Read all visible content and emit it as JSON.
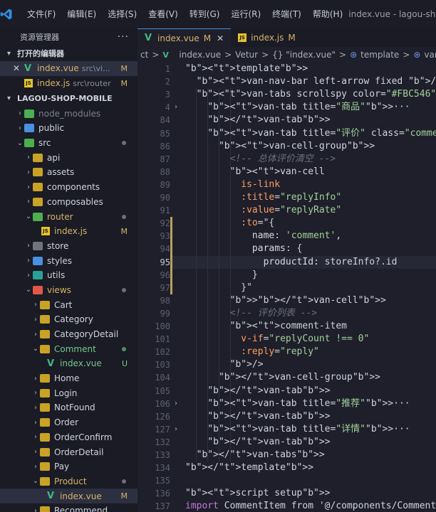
{
  "menubar": {
    "items": [
      "文件(F)",
      "编辑(E)",
      "选择(S)",
      "查看(V)",
      "转到(G)",
      "运行(R)",
      "终端(T)",
      "帮助(H)"
    ],
    "window_title": "index.vue - lagou-sh"
  },
  "explorer": {
    "title": "资源管理器",
    "more": "···",
    "open_editors_label": "打开的编辑器",
    "open_editors": [
      {
        "name": "index.vue",
        "path": "src\\vi...",
        "badge": "M"
      },
      {
        "name": "index.js",
        "path": "src\\router",
        "badge": "M"
      }
    ],
    "project_label": "LAGOU-SHOP-MOBILE",
    "tree": [
      {
        "name": "node_modules"
      },
      {
        "name": "public"
      },
      {
        "name": "src"
      },
      {
        "name": "api"
      },
      {
        "name": "assets"
      },
      {
        "name": "components"
      },
      {
        "name": "composables"
      },
      {
        "name": "router"
      },
      {
        "name": "index.js",
        "badge": "M"
      },
      {
        "name": "store"
      },
      {
        "name": "styles"
      },
      {
        "name": "utils"
      },
      {
        "name": "views"
      },
      {
        "name": "Cart"
      },
      {
        "name": "Category"
      },
      {
        "name": "CategoryDetail"
      },
      {
        "name": "Comment"
      },
      {
        "name": "index.vue",
        "badge": "U"
      },
      {
        "name": "Home"
      },
      {
        "name": "Login"
      },
      {
        "name": "NotFound"
      },
      {
        "name": "Order"
      },
      {
        "name": "OrderConfirm"
      },
      {
        "name": "OrderDetail"
      },
      {
        "name": "Pay"
      },
      {
        "name": "Product"
      },
      {
        "name": "index.vue",
        "badge": "M"
      },
      {
        "name": "Recommend"
      }
    ]
  },
  "tabs": [
    {
      "name": "index.vue",
      "badge": "M",
      "close": "✕"
    },
    {
      "name": "index.js",
      "badge": "M"
    }
  ],
  "breadcrumb": [
    "ct",
    ">",
    "index.vue",
    ">",
    "Vetur",
    ">",
    "{} \"index.vue\"",
    ">",
    "template",
    ">",
    "van-tabs",
    ">"
  ],
  "editor": {
    "line_numbers": [
      "1",
      "2",
      "3",
      "4",
      "84",
      "85",
      "86",
      "87",
      "88",
      "89",
      "90",
      "91",
      "92",
      "93",
      "94",
      "95",
      "96",
      "97",
      "98",
      "99",
      "100",
      "101",
      "102",
      "103",
      "104",
      "105",
      "106",
      "126",
      "127",
      "132",
      "133",
      "134",
      "135",
      "136",
      "137"
    ],
    "lines": [
      "<template>",
      "  <van-nav-bar left-arrow fixed />",
      "  <van-tabs scrollspy color=\"#FBC546\">",
      "    <van-tab title=\"商品\">···",
      "    </van-tab>",
      "    <van-tab title=\"评价\" class=\"comment\">",
      "      <van-cell-group>",
      "        <!-- 总体评价清空 -->",
      "        <van-cell",
      "          is-link",
      "          :title=\"replyInfo\"",
      "          :value=\"replyRate\"",
      "          :to=\"{",
      "            name: 'comment',",
      "            params: {",
      "              productId: storeInfo?.id",
      "            }",
      "          }\"",
      "        ></van-cell>",
      "        <!-- 评价列表 -->",
      "        <comment-item",
      "          v-if=\"replyCount !== 0\"",
      "          :reply=\"reply\"",
      "        />",
      "      </van-cell-group>",
      "    </van-tab>",
      "    <van-tab title=\"推荐\">···",
      "    </van-tab>",
      "    <van-tab title=\"详情\">···",
      "    </van-tab>",
      "  </van-tabs>",
      "</template>",
      "",
      "<script setup>",
      "import CommentItem from '@/components/Comment"
    ]
  },
  "colors": {
    "accent_blue": "#4a90e2",
    "modified": "#d7b36a",
    "untracked": "#73c991",
    "tag": "#ff7a8a"
  }
}
